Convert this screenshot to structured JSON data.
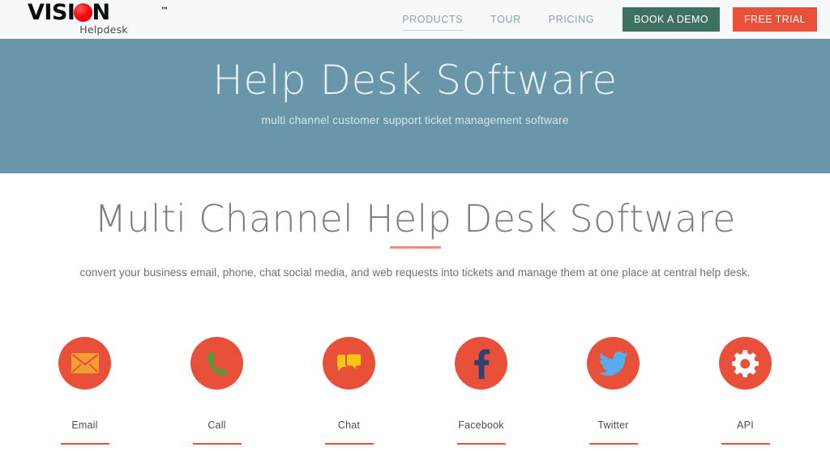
{
  "header": {
    "logo": {
      "word_before": "VISI",
      "word_after": "N",
      "trademark": "™",
      "subtitle": "Helpdesk",
      "dot_color": "#f40d12"
    },
    "nav": [
      {
        "label": "PRODUCTS",
        "active": true
      },
      {
        "label": "TOUR",
        "active": false
      },
      {
        "label": "PRICING",
        "active": false
      }
    ],
    "buttons": {
      "demo_label": "BOOK A DEMO",
      "demo_color": "#3e7063",
      "trial_label": "FREE TRIAL",
      "trial_color": "#e8503a"
    },
    "background": "#f7f8f9"
  },
  "hero": {
    "title": "Help Desk Software",
    "subtitle": "multi channel customer support ticket management software",
    "background": "#6a96aa"
  },
  "section": {
    "title": "Multi Channel Help Desk Software",
    "accent_color": "#f08a7c",
    "subtitle": "convert your business email, phone, chat social media, and web requests into tickets and manage them at one place at central help desk."
  },
  "channels": [
    {
      "label": "Email",
      "icon": "envelope-icon",
      "icon_color": "#f0a030",
      "circle_color": "#e8503a"
    },
    {
      "label": "Call",
      "icon": "phone-icon",
      "icon_color": "#4f9c3a",
      "circle_color": "#e8503a"
    },
    {
      "label": "Chat",
      "icon": "chat-bubbles-icon",
      "icon_color": "#f5c518",
      "circle_color": "#e8503a"
    },
    {
      "label": "Facebook",
      "icon": "facebook-icon",
      "icon_color": "#2d4373",
      "circle_color": "#e8503a"
    },
    {
      "label": "Twitter",
      "icon": "twitter-bird-icon",
      "icon_color": "#55acee",
      "circle_color": "#e8503a"
    },
    {
      "label": "API",
      "icon": "gear-icon",
      "icon_color": "#ffffff",
      "circle_color": "#e8503a"
    }
  ]
}
